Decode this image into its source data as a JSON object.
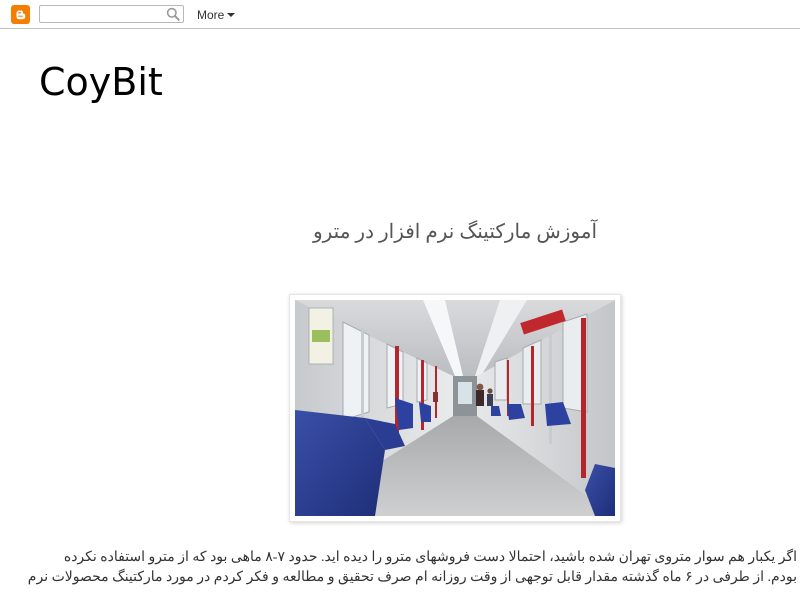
{
  "navbar": {
    "logo_icon": "blogger-icon",
    "search": {
      "value": "",
      "placeholder": ""
    },
    "more_label": "More"
  },
  "blog": {
    "title": "CoyBit"
  },
  "post": {
    "title": "آموزش مارکتینگ نرم افزار در مترو",
    "image_subject": "subway-car-interior",
    "body_lines": [
      "اگر یکبار هم سوار متروی تهران شده باشید، احتمالا دست فروشهای مترو را دیده اید. حدود ۷-۸ ماهی بود که از مترو استفاده نکرده",
      "بودم. از طرفی در ۶ ماه گذشته مقدار قابل توجهی از وقت روزانه ام صرف تحقیق و مطالعه و فکر کردم در مورد مارکتینگ محصولات نرم"
    ]
  },
  "colors": {
    "accent": "#f57d00",
    "navbar_border": "#c0c0c0",
    "post_title": "#555555",
    "body_text": "#333333"
  }
}
